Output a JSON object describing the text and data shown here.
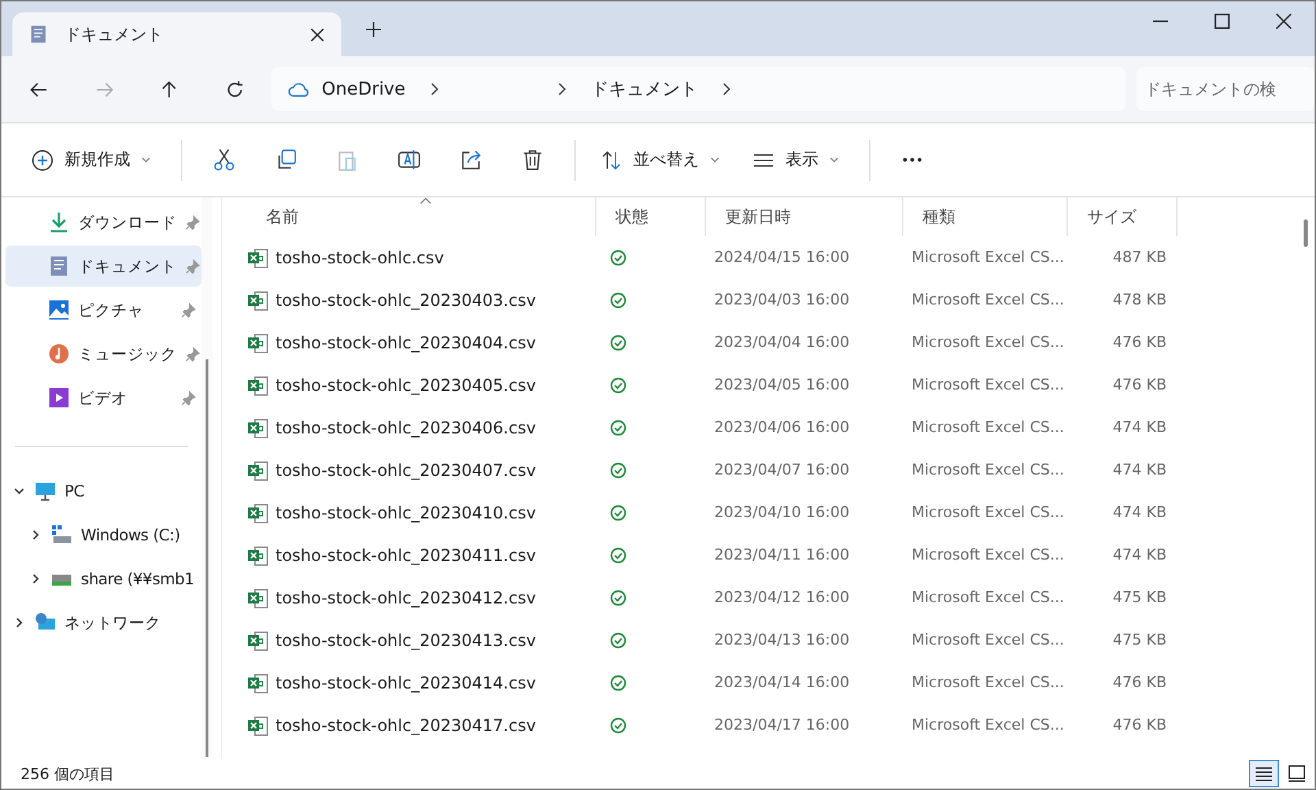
{
  "window": {
    "tab_title": "ドキュメント"
  },
  "breadcrumb": [
    "OneDrive",
    "ドキュメント"
  ],
  "search": {
    "placeholder": "ドキュメントの検"
  },
  "toolbar": {
    "new": "新規作成",
    "sort": "並べ替え",
    "view": "表示"
  },
  "sidebar": {
    "quick": [
      {
        "label": "ダウンロード",
        "selected": false
      },
      {
        "label": "ドキュメント",
        "selected": true
      },
      {
        "label": "ピクチャ",
        "selected": false
      },
      {
        "label": "ミュージック",
        "selected": false
      },
      {
        "label": "ビデオ",
        "selected": false
      }
    ],
    "tree": [
      {
        "label": "PC",
        "expanded": true,
        "children": [
          {
            "label": "Windows (C:)",
            "expanded": false
          },
          {
            "label": "share (¥¥smb1",
            "expanded": false
          }
        ]
      },
      {
        "label": "ネットワーク",
        "expanded": false
      }
    ]
  },
  "table": {
    "columns": [
      "名前",
      "状態",
      "更新日時",
      "種類",
      "サイズ"
    ],
    "rows": [
      [
        "tosho-stock-ohlc.csv",
        "",
        "2024/04/15 16:00",
        "Microsoft Excel CS...",
        "487 KB"
      ],
      [
        "tosho-stock-ohlc_20230403.csv",
        "",
        "2023/04/03 16:00",
        "Microsoft Excel CS...",
        "478 KB"
      ],
      [
        "tosho-stock-ohlc_20230404.csv",
        "",
        "2023/04/04 16:00",
        "Microsoft Excel CS...",
        "476 KB"
      ],
      [
        "tosho-stock-ohlc_20230405.csv",
        "",
        "2023/04/05 16:00",
        "Microsoft Excel CS...",
        "476 KB"
      ],
      [
        "tosho-stock-ohlc_20230406.csv",
        "",
        "2023/04/06 16:00",
        "Microsoft Excel CS...",
        "474 KB"
      ],
      [
        "tosho-stock-ohlc_20230407.csv",
        "",
        "2023/04/07 16:00",
        "Microsoft Excel CS...",
        "474 KB"
      ],
      [
        "tosho-stock-ohlc_20230410.csv",
        "",
        "2023/04/10 16:00",
        "Microsoft Excel CS...",
        "474 KB"
      ],
      [
        "tosho-stock-ohlc_20230411.csv",
        "",
        "2023/04/11 16:00",
        "Microsoft Excel CS...",
        "474 KB"
      ],
      [
        "tosho-stock-ohlc_20230412.csv",
        "",
        "2023/04/12 16:00",
        "Microsoft Excel CS...",
        "475 KB"
      ],
      [
        "tosho-stock-ohlc_20230413.csv",
        "",
        "2023/04/13 16:00",
        "Microsoft Excel CS...",
        "475 KB"
      ],
      [
        "tosho-stock-ohlc_20230414.csv",
        "",
        "2023/04/14 16:00",
        "Microsoft Excel CS...",
        "476 KB"
      ],
      [
        "tosho-stock-ohlc_20230417.csv",
        "",
        "2023/04/17 16:00",
        "Microsoft Excel CS...",
        "476 KB"
      ]
    ]
  },
  "status_bar": {
    "count": "256 個の項目",
    "views": [
      {
        "kind": "details",
        "selected": true
      },
      {
        "kind": "tiles",
        "selected": false
      }
    ]
  }
}
